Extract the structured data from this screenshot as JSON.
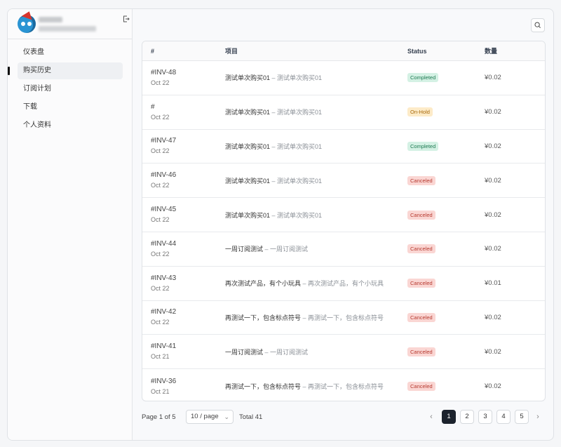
{
  "sidebar": {
    "items": [
      {
        "label": "仪表盘"
      },
      {
        "label": "购买历史",
        "active": true
      },
      {
        "label": "订阅计划"
      },
      {
        "label": "下载"
      },
      {
        "label": "个人资料"
      }
    ]
  },
  "table": {
    "headers": [
      "#",
      "项目",
      "Status",
      "数量"
    ],
    "rows": [
      {
        "inv": "#INV-48",
        "date": "Oct 22",
        "item": "测试单次购买01",
        "sub": " – 测试单次购买01",
        "status": "Completed",
        "amount": "¥0.02"
      },
      {
        "inv": "#",
        "date": "Oct 22",
        "item": "测试单次购买01",
        "sub": " – 测试单次购买01",
        "status": "On-Hold",
        "amount": "¥0.02"
      },
      {
        "inv": "#INV-47",
        "date": "Oct 22",
        "item": "测试单次购买01",
        "sub": " – 测试单次购买01",
        "status": "Completed",
        "amount": "¥0.02"
      },
      {
        "inv": "#INV-46",
        "date": "Oct 22",
        "item": "测试单次购买01",
        "sub": " – 测试单次购买01",
        "status": "Canceled",
        "amount": "¥0.02"
      },
      {
        "inv": "#INV-45",
        "date": "Oct 22",
        "item": "测试单次购买01",
        "sub": " – 测试单次购买01",
        "status": "Canceled",
        "amount": "¥0.02"
      },
      {
        "inv": "#INV-44",
        "date": "Oct 22",
        "item": "一周订阅测试",
        "sub": " – 一周订阅测试",
        "status": "Canceled",
        "amount": "¥0.02"
      },
      {
        "inv": "#INV-43",
        "date": "Oct 22",
        "item": "再次测试产品，有个小玩具",
        "sub": " – 再次测试产品，有个小玩具",
        "status": "Canceled",
        "amount": "¥0.01"
      },
      {
        "inv": "#INV-42",
        "date": "Oct 22",
        "item": "再测试一下，包含标点符号",
        "sub": " – 再测试一下，包含标点符号",
        "status": "Canceled",
        "amount": "¥0.02"
      },
      {
        "inv": "#INV-41",
        "date": "Oct 21",
        "item": "一周订阅测试",
        "sub": " – 一周订阅测试",
        "status": "Canceled",
        "amount": "¥0.02"
      },
      {
        "inv": "#INV-36",
        "date": "Oct 21",
        "item": "再测试一下，包含标点符号",
        "sub": " – 再测试一下，包含标点符号",
        "status": "Canceled",
        "amount": "¥0.02"
      }
    ]
  },
  "status_colors": {
    "Completed": {
      "bg": "#d4f1e4",
      "fg": "#1e7a52"
    },
    "On-Hold": {
      "bg": "#fdebc8",
      "fg": "#a86a0c"
    },
    "Canceled": {
      "bg": "#fad6d3",
      "fg": "#b73a30"
    }
  },
  "pagination": {
    "page_text": "Page 1 of 5",
    "per_page": "10 / page",
    "total": "Total 41",
    "pages": [
      "1",
      "2",
      "3",
      "4",
      "5"
    ],
    "current": "1"
  },
  "icons": {
    "logout": "logout-icon",
    "search": "search-icon",
    "prev": "chevron-left-icon",
    "next": "chevron-right-icon"
  }
}
